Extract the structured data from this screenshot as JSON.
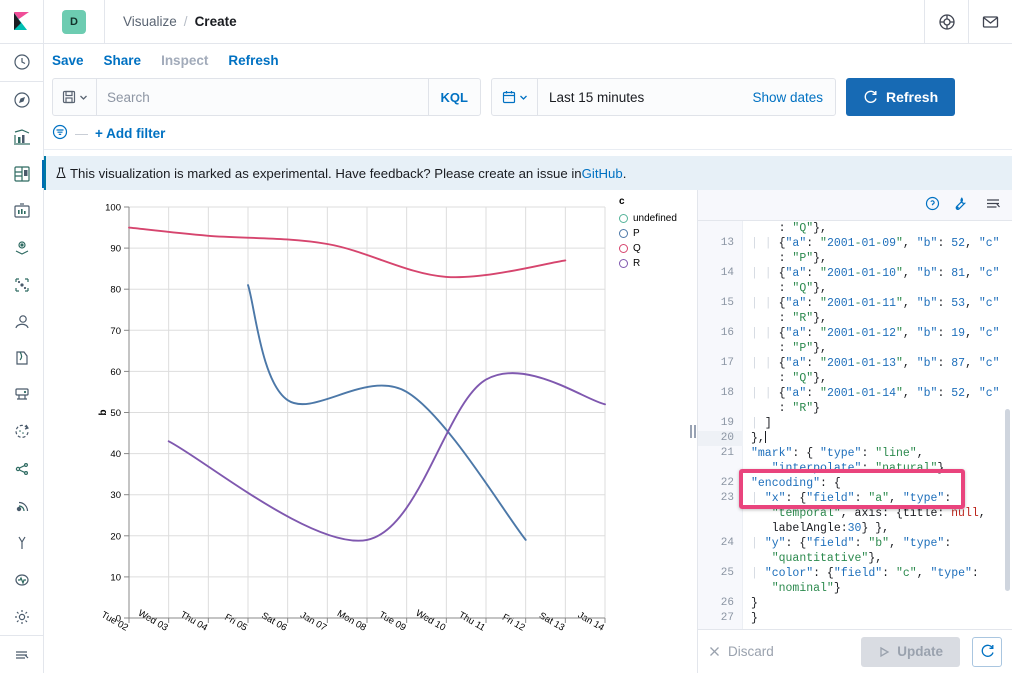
{
  "header": {
    "space_initial": "D",
    "breadcrumb_parent": "Visualize",
    "breadcrumb_slash": "/",
    "breadcrumb_current": "Create",
    "help_icon": "help-ring-icon",
    "mail_icon": "mail-icon",
    "logo_icon": "elastic-kibana-logo"
  },
  "actions": {
    "save": "Save",
    "share": "Share",
    "inspect": "Inspect",
    "refresh": "Refresh"
  },
  "query": {
    "saved_query_icon": "save-disk-icon",
    "saved_query_caret": "chevron-down-icon",
    "search_value": "",
    "search_placeholder": "Search",
    "language": "KQL",
    "calendar_icon": "calendar-icon",
    "calendar_caret": "chevron-down-icon",
    "date_range": "Last 15 minutes",
    "show_dates": "Show dates",
    "refresh_button": "Refresh",
    "refresh_icon": "refresh-icon"
  },
  "filters": {
    "filter_icon": "filter-icon",
    "dash": "—",
    "add_filter": "+ Add filter"
  },
  "callout": {
    "warning_icon": "beaker-icon",
    "text_before": "This visualization is marked as experimental. Have feedback? Please create an issue in ",
    "link": "GitHub",
    "text_after": "."
  },
  "sidebar": {
    "items": [
      {
        "name": "recently-viewed-icon",
        "label": "Recently viewed"
      },
      {
        "name": "discover-icon",
        "label": "Discover"
      },
      {
        "name": "visualize-icon",
        "label": "Visualize"
      },
      {
        "name": "dashboard-icon",
        "label": "Dashboard"
      },
      {
        "name": "canvas-icon",
        "label": "Canvas"
      },
      {
        "name": "maps-icon",
        "label": "Maps"
      },
      {
        "name": "machine-learning-icon",
        "label": "Machine Learning"
      },
      {
        "name": "infrastructure-icon",
        "label": "Infrastructure"
      },
      {
        "name": "logs-icon",
        "label": "Logs"
      },
      {
        "name": "apm-icon",
        "label": "APM"
      },
      {
        "name": "uptime-icon",
        "label": "Uptime"
      },
      {
        "name": "siem-icon",
        "label": "SIEM"
      },
      {
        "name": "monitoring-icon",
        "label": "Monitoring"
      },
      {
        "name": "dev-tools-icon",
        "label": "Dev Tools"
      },
      {
        "name": "stack-management-icon",
        "label": "Stack Management"
      },
      {
        "name": "collapse-nav-icon",
        "label": "Collapse"
      }
    ]
  },
  "editor": {
    "help_icon": "question-circle-icon",
    "wrench_icon": "wrench-icon",
    "collapse_icon": "collapse-panel-icon",
    "discard_label": "Discard",
    "discard_icon": "close-icon",
    "update_label": "Update",
    "update_icon": "play-icon",
    "rerun_icon": "refresh-icon",
    "highlight_color": "#e9447d",
    "lines": [
      {
        "num": "",
        "text": "    : \"Q\"},"
      },
      {
        "num": "13",
        "text": "| | {\"a\": \"2001-01-09\", \"b\": 52, \"c\"\n    : \"P\"},"
      },
      {
        "num": "14",
        "text": "| | {\"a\": \"2001-01-10\", \"b\": 81, \"c\"\n    : \"Q\"},"
      },
      {
        "num": "15",
        "text": "| | {\"a\": \"2001-01-11\", \"b\": 53, \"c\"\n    : \"R\"},"
      },
      {
        "num": "16",
        "text": "| | {\"a\": \"2001-01-12\", \"b\": 19, \"c\"\n    : \"P\"},"
      },
      {
        "num": "17",
        "text": "| | {\"a\": \"2001-01-13\", \"b\": 87, \"c\"\n    : \"Q\"},"
      },
      {
        "num": "18",
        "text": "| | {\"a\": \"2001-01-14\", \"b\": 52, \"c\"\n    : \"R\"}"
      },
      {
        "num": "19",
        "text": "| ]"
      },
      {
        "num": "20",
        "text": "},"
      },
      {
        "num": "21",
        "text": "\"mark\": { \"type\": \"line\",\n   \"interpolate\": \"natural\"},"
      },
      {
        "num": "22",
        "text": "\"encoding\": {"
      },
      {
        "num": "23",
        "text": "| \"x\": {\"field\": \"a\", \"type\":\n   \"temporal\", axis: {title: null,\n   labelAngle:30} },"
      },
      {
        "num": "24",
        "text": "| \"y\": {\"field\": \"b\", \"type\":\n   \"quantitative\"},"
      },
      {
        "num": "25",
        "text": "| \"color\": {\"field\": \"c\", \"type\":\n   \"nominal\"}"
      },
      {
        "num": "26",
        "text": "}"
      },
      {
        "num": "27",
        "text": "}"
      }
    ]
  },
  "chart_data": {
    "type": "line",
    "title": "",
    "xlabel": "",
    "ylabel": "b",
    "ylim": [
      0,
      100
    ],
    "yticks": [
      0,
      10,
      20,
      30,
      40,
      50,
      60,
      70,
      80,
      90,
      100
    ],
    "x_tick_labels": [
      "Tue 02",
      "Wed 03",
      "Thu 04",
      "Fri 05",
      "Sat 06",
      "Jan 07",
      "Mon 08",
      "Tue 09",
      "Wed 10",
      "Thu 11",
      "Fri 12",
      "Sat 13",
      "Jan 14"
    ],
    "x_label_angle": 30,
    "interpolate": "natural",
    "grid": true,
    "legend": {
      "title": "c",
      "position": "right",
      "entries": [
        {
          "label": "undefined",
          "color": "#54b399"
        },
        {
          "label": "P",
          "color": "#4c78a8"
        },
        {
          "label": "Q",
          "color": "#d6456e"
        },
        {
          "label": "R",
          "color": "#7f58af"
        }
      ]
    },
    "series": [
      {
        "name": "Q",
        "color": "#d6456e",
        "x": [
          "2001-01-02",
          "2001-01-04",
          "2001-01-07",
          "2001-01-10",
          "2001-01-13"
        ],
        "values": [
          95,
          93,
          91,
          83,
          87
        ]
      },
      {
        "name": "P",
        "color": "#4c78a8",
        "x": [
          "2001-01-05",
          "2001-01-06",
          "2001-01-09",
          "2001-01-12"
        ],
        "values": [
          81,
          53,
          55,
          19
        ]
      },
      {
        "name": "R",
        "color": "#7f58af",
        "x": [
          "2001-01-03",
          "2001-01-08",
          "2001-01-11",
          "2001-01-14"
        ],
        "values": [
          43,
          19,
          58,
          52
        ]
      }
    ]
  }
}
